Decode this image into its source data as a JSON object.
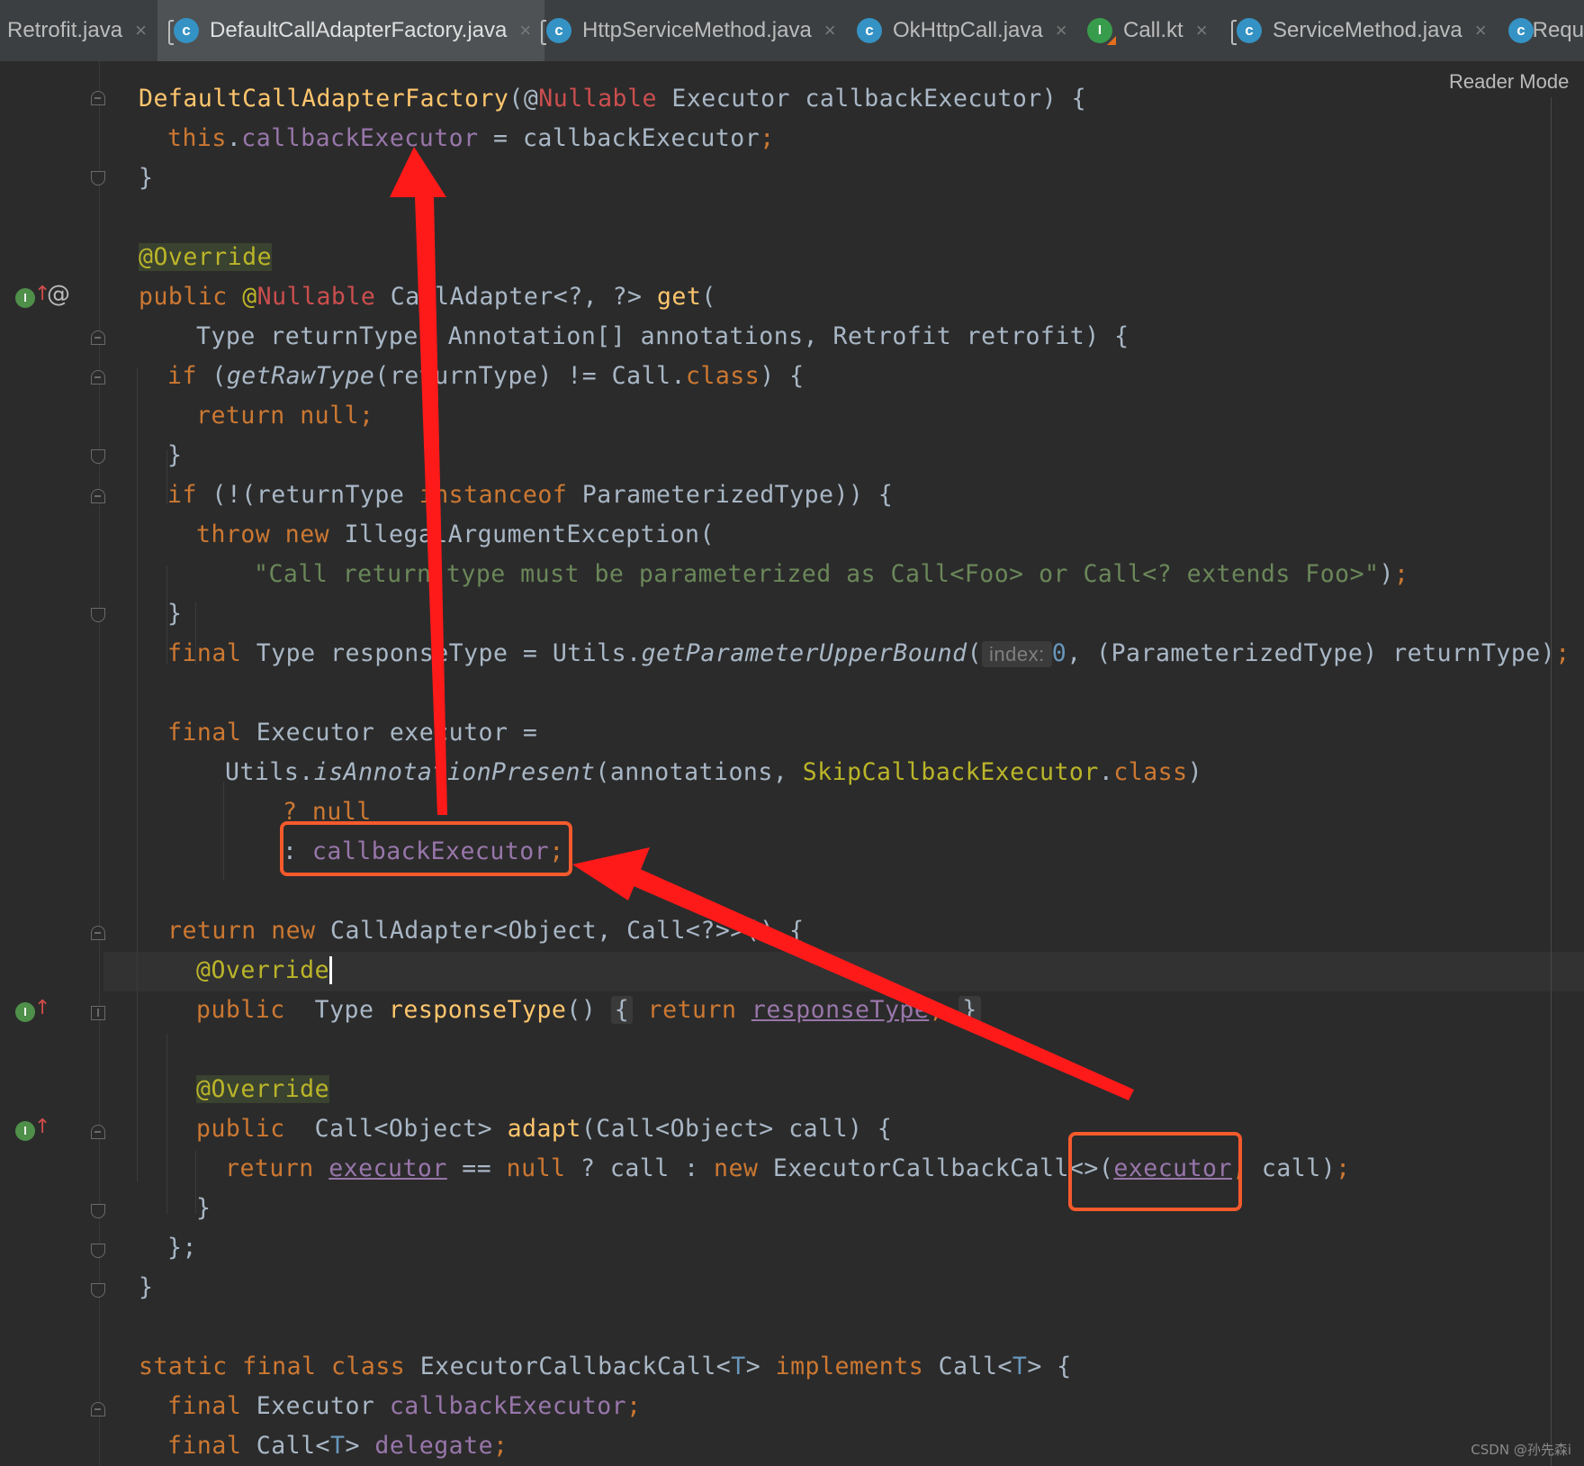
{
  "tabs": [
    {
      "label": "Retrofit.java",
      "icon": "java-class-icon",
      "active": false
    },
    {
      "label": "DefaultCallAdapterFactory.java",
      "icon": "java-class-icon",
      "active": true
    },
    {
      "label": "HttpServiceMethod.java",
      "icon": "java-class-icon",
      "active": false
    },
    {
      "label": "OkHttpCall.java",
      "icon": "java-class-icon",
      "active": false
    },
    {
      "label": "Call.kt",
      "icon": "kotlin-interface-icon",
      "active": false
    },
    {
      "label": "ServiceMethod.java",
      "icon": "java-class-icon",
      "active": false
    },
    {
      "label": "Requ",
      "icon": "java-class-icon",
      "active": false
    }
  ],
  "close_glyph": "×",
  "reader_mode": "Reader Mode",
  "watermark": "CSDN @孙先森i",
  "code": {
    "l1_name": "DefaultCallAdapterFactory",
    "l1_open": "(@",
    "l1_nullable": "Nullable",
    "l1_rest": " Executor callbackExecutor) {",
    "l2_this": "this",
    "l2_dot": ".",
    "l2_field": "callbackExecutor",
    "l2_rest": " = callbackExecutor",
    "semi": ";",
    "brace_close": "}",
    "override": "@Override",
    "l5_public": "public ",
    "l5_at": "@",
    "l5_nullable": "Nullable",
    "l5_rest": " CallAdapter<?, ?> ",
    "l5_get": "get",
    "l5_paren": "(",
    "l6_text": "Type returnType, Annotation[] annotations, Retrofit retrofit) {",
    "if_kw": "if",
    "l7_a": " (",
    "l7_call": "getRawType",
    "l7_b": "(returnType) != Call.",
    "class_kw": "class",
    "l7_c": ") {",
    "return_kw": "return",
    "null_kw": "null",
    "l10_a": " (!(returnType ",
    "instanceof_kw": "instanceof",
    "l10_b": " ParameterizedType)) {",
    "throw_kw": "throw",
    "new_kw": "new",
    "l11_rest": " IllegalArgumentException(",
    "l12_str": "\"Call return type must be parameterized as Call<Foo> or Call<? extends Foo>\"",
    "l12_end": ")",
    "final_kw": "final",
    "l14_a": " Type responseType = Utils.",
    "l14_call": "getParameterUpperBound",
    "l14_paren": "(",
    "l14_hint": "index:",
    "l14_num": "0",
    "l14_b": ", (ParameterizedType) returnType)",
    "l16_rest": " Executor executor =",
    "l17_a": "Utils.",
    "l17_call": "isAnnotationPresent",
    "l17_b": "(annotations, ",
    "l17_ann": "SkipCallbackExecutor",
    "l17_c": ".",
    "l17_d": ")",
    "l18_q": "? ",
    "l19_colon": ": ",
    "l19_field": "callbackExecutor",
    "l21_rest": " CallAdapter<Object, Call<?>>() {",
    "l23_rest": " Type ",
    "l23_fn": "responseType",
    "l23_parens": "() ",
    "l23_ob": "{",
    "l23_ret": " return ",
    "l23_field": "responseType",
    "l23_cb": "}",
    "l26_a": " Call<Object> ",
    "l26_fn": "adapt",
    "l26_b": "(Call<Object> call) {",
    "l27_var": "executor",
    "l27_a": " == ",
    "l27_b": " ? call : ",
    "l27_c": " ExecutorCallbackCall<>(",
    "l27_var2": "executor",
    "l27_comma": ", ",
    "l27_d": "call)",
    "l30_close": "};",
    "static_kw": "static",
    "class_kw2": "class",
    "implements_kw": "implements",
    "l33_a": " ExecutorCallbackCall<",
    "l33_t": "T",
    "l33_b": "> ",
    "l33_c": " Call<",
    "l33_d": "> {",
    "l34_a": " Executor ",
    "l34_field": "callbackExecutor",
    "l35_a": " Call<",
    "l35_b": "> ",
    "l35_field": "delegate"
  },
  "gutter": {
    "impl_marker": "I",
    "up_arrow": "↑",
    "at": "@"
  }
}
